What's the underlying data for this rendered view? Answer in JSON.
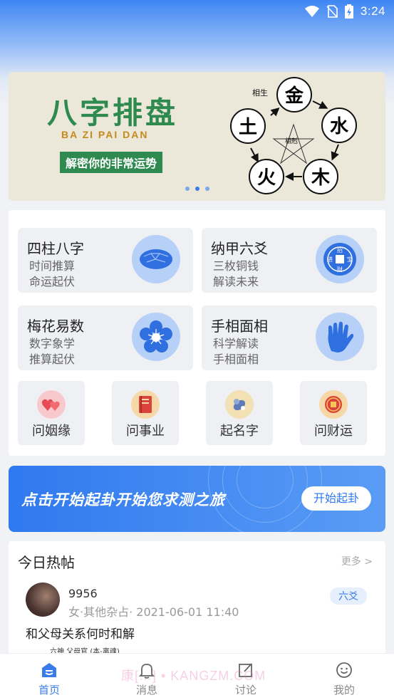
{
  "status_bar": {
    "time": "3:24",
    "icons": [
      "wifi-icon",
      "no-sim-icon",
      "battery-charging-icon"
    ]
  },
  "banner": {
    "title": "八字排盘",
    "pinyin": "BA ZI PAI DAN",
    "tagline": "解密你的非常运势",
    "wheel": {
      "elements": [
        "金",
        "水",
        "木",
        "火",
        "土"
      ],
      "sheng_label": "相生",
      "ke_label": "相剋"
    },
    "dots": 3,
    "active_dot": 1
  },
  "menu": {
    "tiles": [
      {
        "title": "四柱八字",
        "sub1": "时间推算",
        "sub2": "命运起伏",
        "icon": "turtle-shell-icon"
      },
      {
        "title": "纳甲六爻",
        "sub1": "三枚铜钱",
        "sub2": "解读未来",
        "icon": "coin-icon",
        "coin": [
          "招",
          "进",
          "宝",
          "财"
        ]
      },
      {
        "title": "梅花易数",
        "sub1": "数字象学",
        "sub2": "推算起伏",
        "icon": "plum-blossom-icon"
      },
      {
        "title": "手相面相",
        "sub1": "科学解读",
        "sub2": "手相面相",
        "icon": "palm-icon"
      }
    ],
    "shortcuts": [
      {
        "label": "问姻缘",
        "icon": "hearts-icon"
      },
      {
        "label": "问事业",
        "icon": "book-icon"
      },
      {
        "label": "起名字",
        "icon": "name-icon"
      },
      {
        "label": "问财运",
        "icon": "wealth-coin-icon"
      }
    ]
  },
  "start_banner": {
    "text": "点击开始起卦开始您求测之旅",
    "button": "开始起卦"
  },
  "hot_posts": {
    "heading": "今日热帖",
    "more": "更多 >",
    "post": {
      "username": "9956",
      "meta": "女·其他杂占· 2021-06-01 11:40",
      "tag": "六爻",
      "title": "和父母关系何时和解",
      "snippet": "六神  父母官 (本-离魂)"
    }
  },
  "tabs": [
    {
      "label": "首页",
      "icon": "home-icon",
      "active": true
    },
    {
      "label": "消息",
      "icon": "bell-icon",
      "active": false
    },
    {
      "label": "讨论",
      "icon": "edit-icon",
      "active": false
    },
    {
      "label": "我的",
      "icon": "smiley-icon",
      "active": false
    }
  ],
  "watermark": "康[…] • KANGZM.COM",
  "colors": {
    "accent": "#3a7bea",
    "banner_green": "#2e8a4e",
    "banner_bg": "#ebe7d9"
  }
}
